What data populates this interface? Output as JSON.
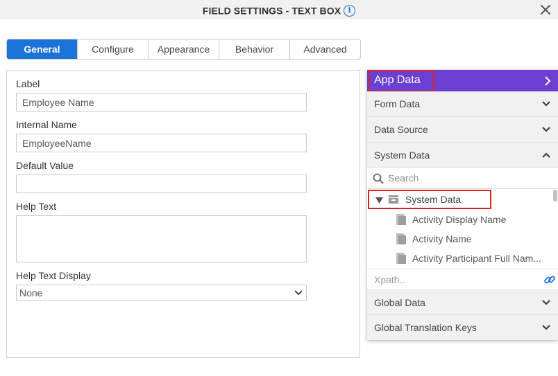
{
  "dialog": {
    "title": "FIELD SETTINGS - TEXT BOX",
    "info_icon": "info-icon",
    "close_icon": "close-icon"
  },
  "tabs": [
    {
      "label": "General",
      "active": true
    },
    {
      "label": "Configure",
      "active": false
    },
    {
      "label": "Appearance",
      "active": false
    },
    {
      "label": "Behavior",
      "active": false
    },
    {
      "label": "Advanced",
      "active": false
    }
  ],
  "general": {
    "label_field": {
      "label": "Label",
      "value": "Employee Name"
    },
    "internal_name_field": {
      "label": "Internal Name",
      "value": "EmployeeName"
    },
    "default_value_field": {
      "label": "Default Value",
      "value": ""
    },
    "help_text_field": {
      "label": "Help Text",
      "value": ""
    },
    "help_text_display_field": {
      "label": "Help Text Display",
      "selected": "None"
    }
  },
  "app_data": {
    "header": "App Data",
    "sections": {
      "form_data": "Form Data",
      "data_source": "Data Source",
      "system_data": "System Data",
      "global_data": "Global Data",
      "global_translation_keys": "Global Translation Keys"
    },
    "search_placeholder": "Search",
    "tree": {
      "root": "System Data",
      "items": [
        "Activity Display Name",
        "Activity Name",
        "Activity Participant Full Nam..."
      ]
    },
    "xpath_placeholder": "Xpath.."
  },
  "colors": {
    "accent_blue": "#1a73d9",
    "app_data_purple": "#6a3fd2",
    "highlight_red": "#e02020"
  }
}
